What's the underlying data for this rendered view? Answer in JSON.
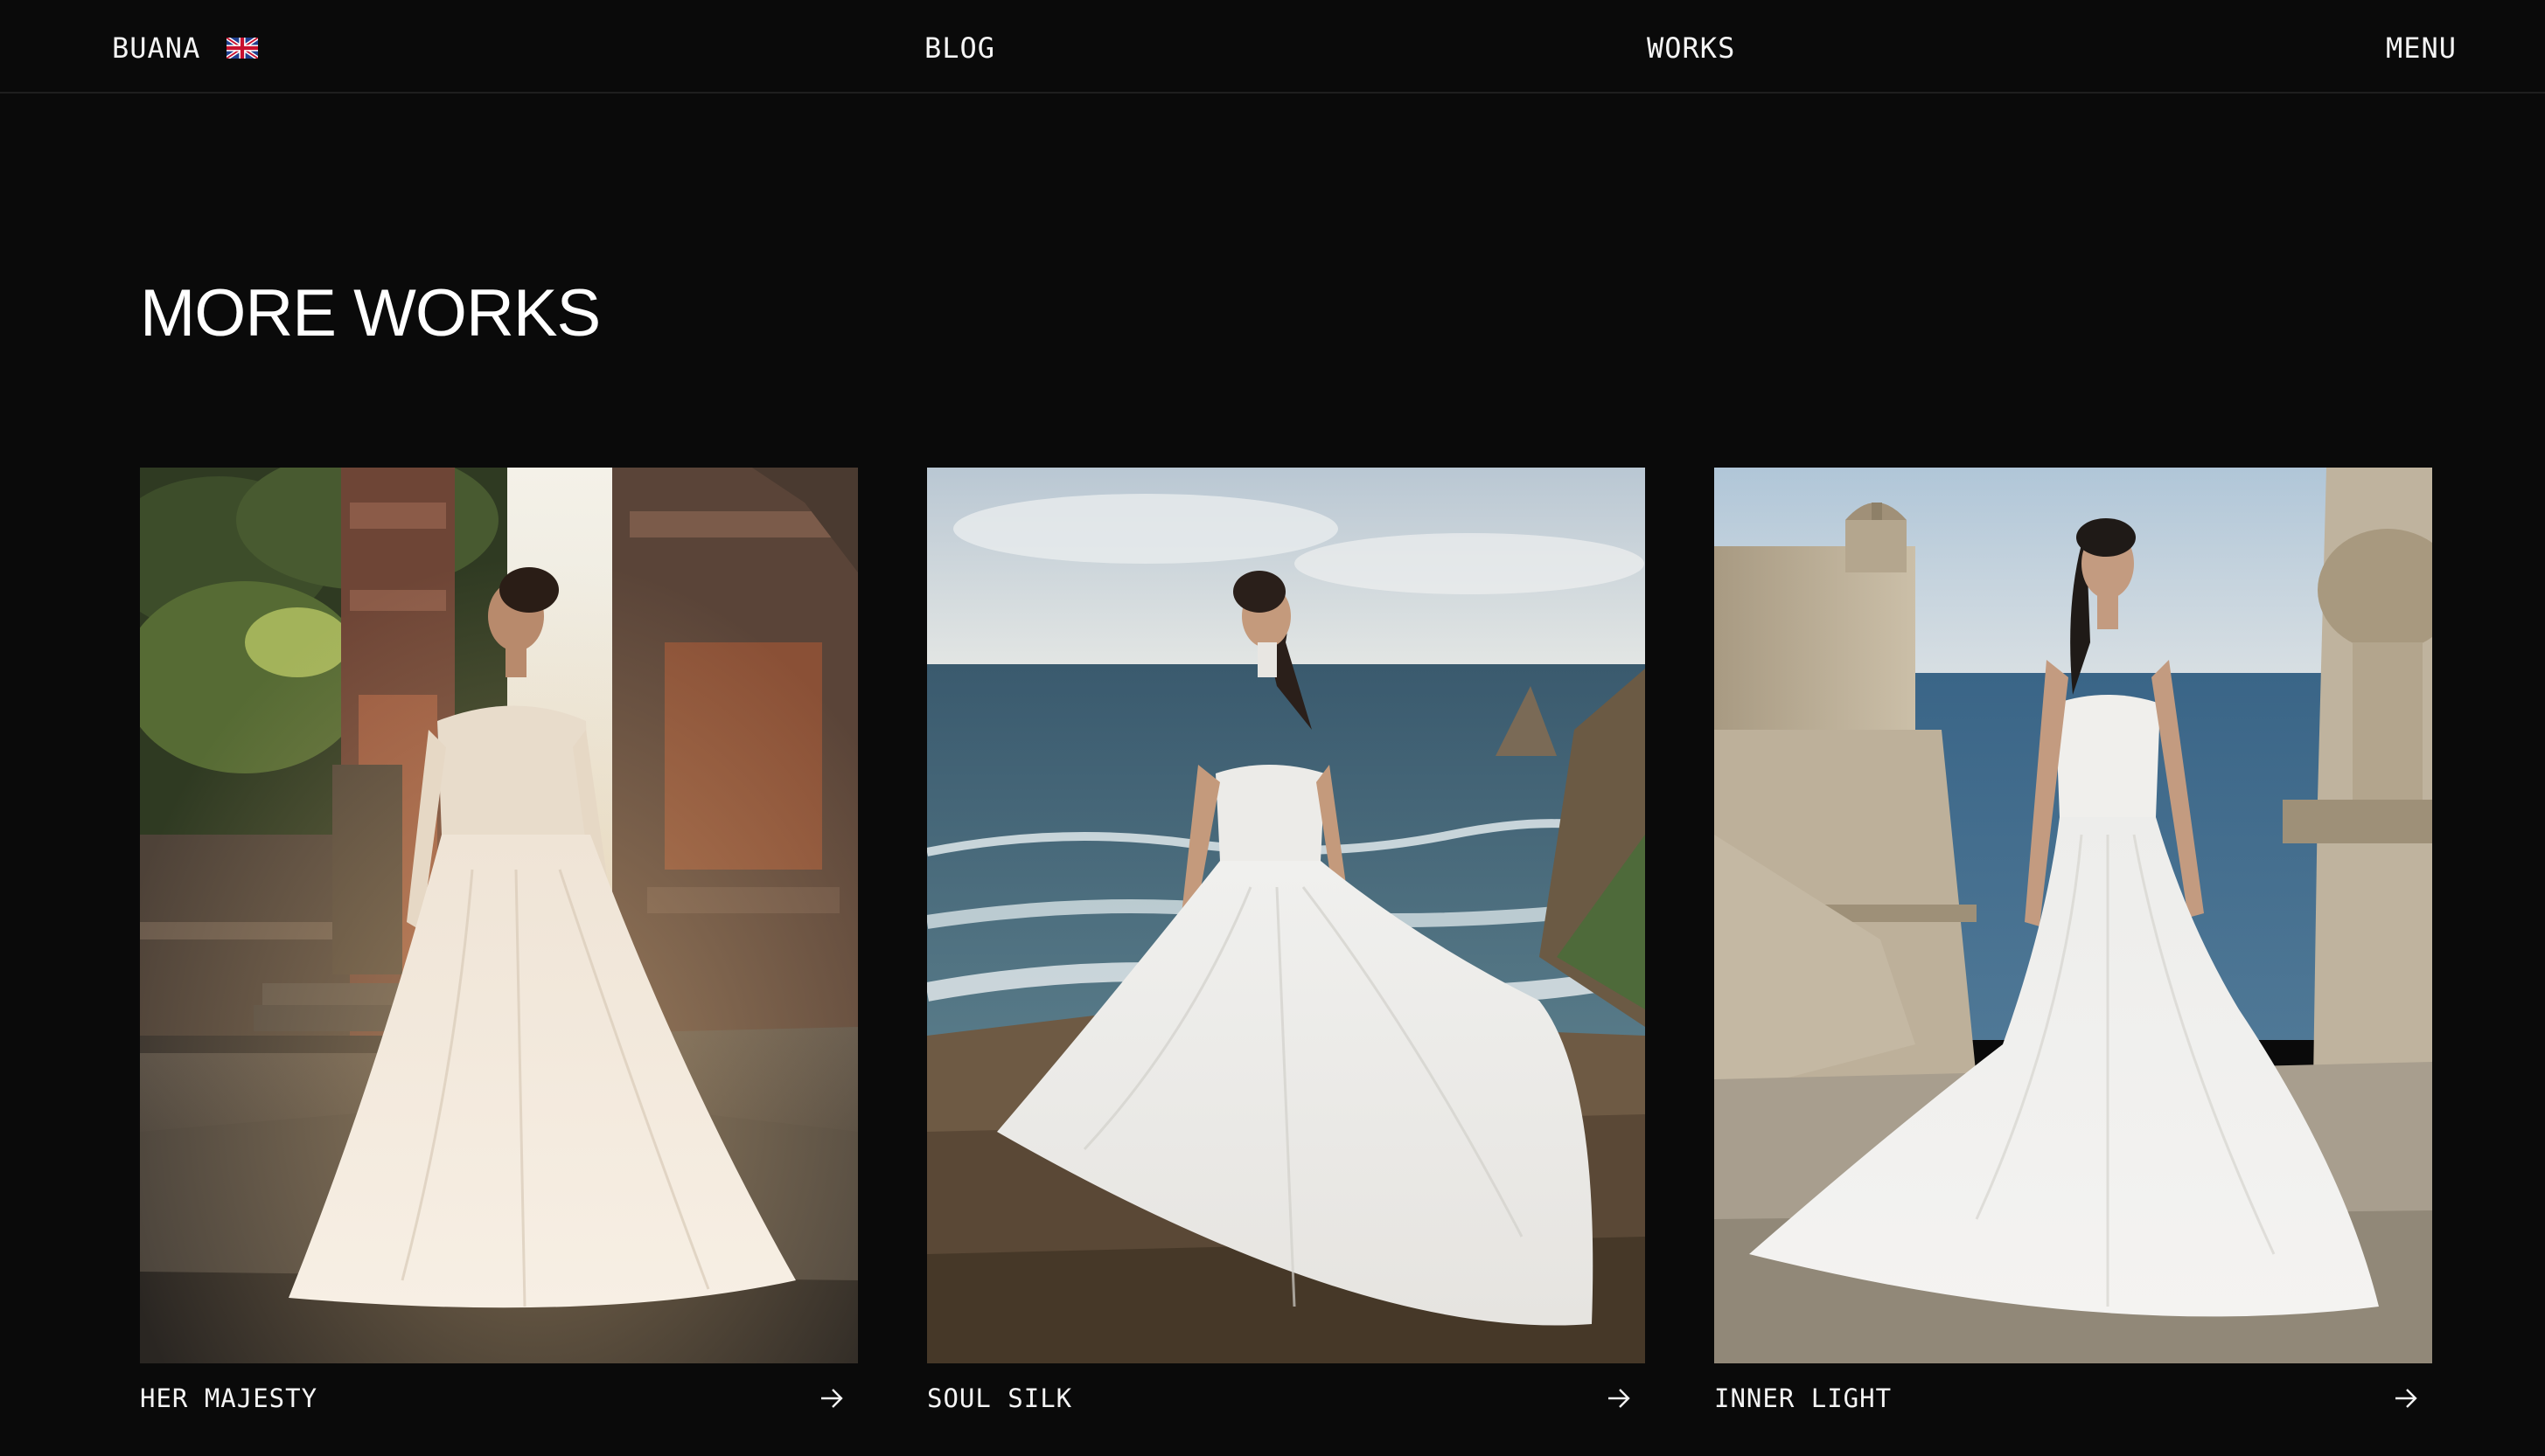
{
  "header": {
    "brand": "BUANA",
    "language_icon": "uk-flag-icon",
    "nav": {
      "blog": "BLOG",
      "works": "WORKS",
      "menu": "MENU"
    }
  },
  "section": {
    "title": "MORE WORKS"
  },
  "works": [
    {
      "title": "HER MAJESTY",
      "image": "bride-lace-gown-bali-temple-photo",
      "action_icon": "arrow-right-icon"
    },
    {
      "title": "SOUL SILK",
      "image": "bride-tulle-gown-ocean-cliff-photo",
      "action_icon": "arrow-right-icon"
    },
    {
      "title": "INNER LIGHT",
      "image": "bride-mermaid-gown-coastal-fortress-photo",
      "action_icon": "arrow-right-icon"
    }
  ],
  "colors": {
    "background": "#0a0a0a",
    "text": "#f4f4f4",
    "divider": "#1f1f1f"
  }
}
